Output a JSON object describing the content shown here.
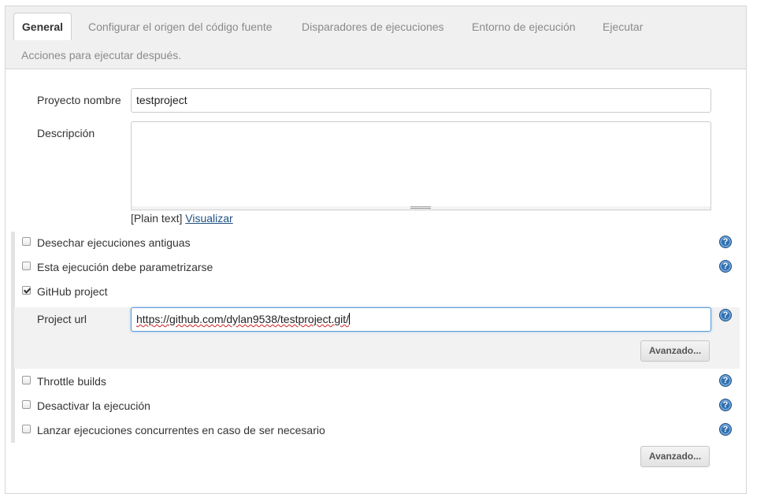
{
  "tabs": [
    {
      "label": "General",
      "active": true
    },
    {
      "label": "Configurar el origen del código fuente"
    },
    {
      "label": "Disparadores de ejecuciones"
    },
    {
      "label": "Entorno de ejecución"
    },
    {
      "label": "Ejecutar"
    },
    {
      "label": "Acciones para ejecutar después."
    }
  ],
  "form": {
    "project_name_label": "Proyecto nombre",
    "project_name_value": "testproject",
    "description_label": "Descripción",
    "description_value": "",
    "plain_text": "[Plain text]",
    "preview_link": "Visualizar"
  },
  "options": [
    {
      "label": "Desechar ejecuciones antiguas",
      "checked": false
    },
    {
      "label": "Esta ejecución debe parametrizarse",
      "checked": false
    },
    {
      "label": "GitHub project",
      "checked": true
    }
  ],
  "github": {
    "project_url_label": "Project url",
    "project_url_value": "https://github.com/dylan9538/testproject.git/",
    "advanced_button": "Avanzado..."
  },
  "options2": [
    {
      "label": "Throttle builds",
      "checked": false
    },
    {
      "label": "Desactivar la ejecución",
      "checked": false
    },
    {
      "label": "Lanzar ejecuciones concurrentes en caso de ser necesario",
      "checked": false
    }
  ],
  "advanced_button": "Avanzado...",
  "help_glyph": "?",
  "colors": {
    "accent": "#2f6fae",
    "link": "#205081",
    "tab_bg": "#f0f0f0"
  },
  "icons": {
    "help": "help-icon",
    "checkbox": "checkbox"
  }
}
